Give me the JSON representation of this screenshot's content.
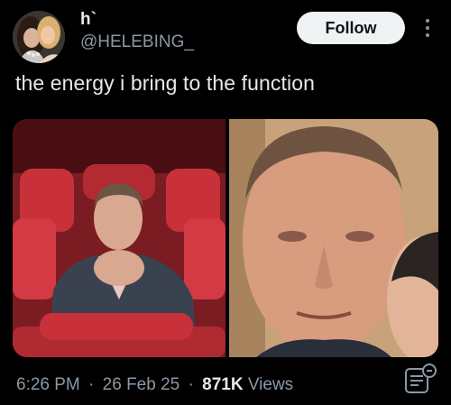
{
  "author": {
    "display_name": "h`",
    "handle": "@HELEBING_"
  },
  "actions": {
    "follow_label": "Follow",
    "more_icon": "more-vertical-icon"
  },
  "tweet": {
    "text": "the energy i bring to the function"
  },
  "meta": {
    "time": "6:26 PM",
    "separator": "·",
    "date": "26 Feb 25",
    "views_count": "871K",
    "views_label": "Views"
  },
  "icons": {
    "analytics": "analytics-icon"
  },
  "colors": {
    "background": "#000000",
    "text_primary": "#e7e9ea",
    "text_secondary": "#8b98a5",
    "follow_button_bg": "#eff3f4",
    "follow_button_text": "#0f1419"
  }
}
